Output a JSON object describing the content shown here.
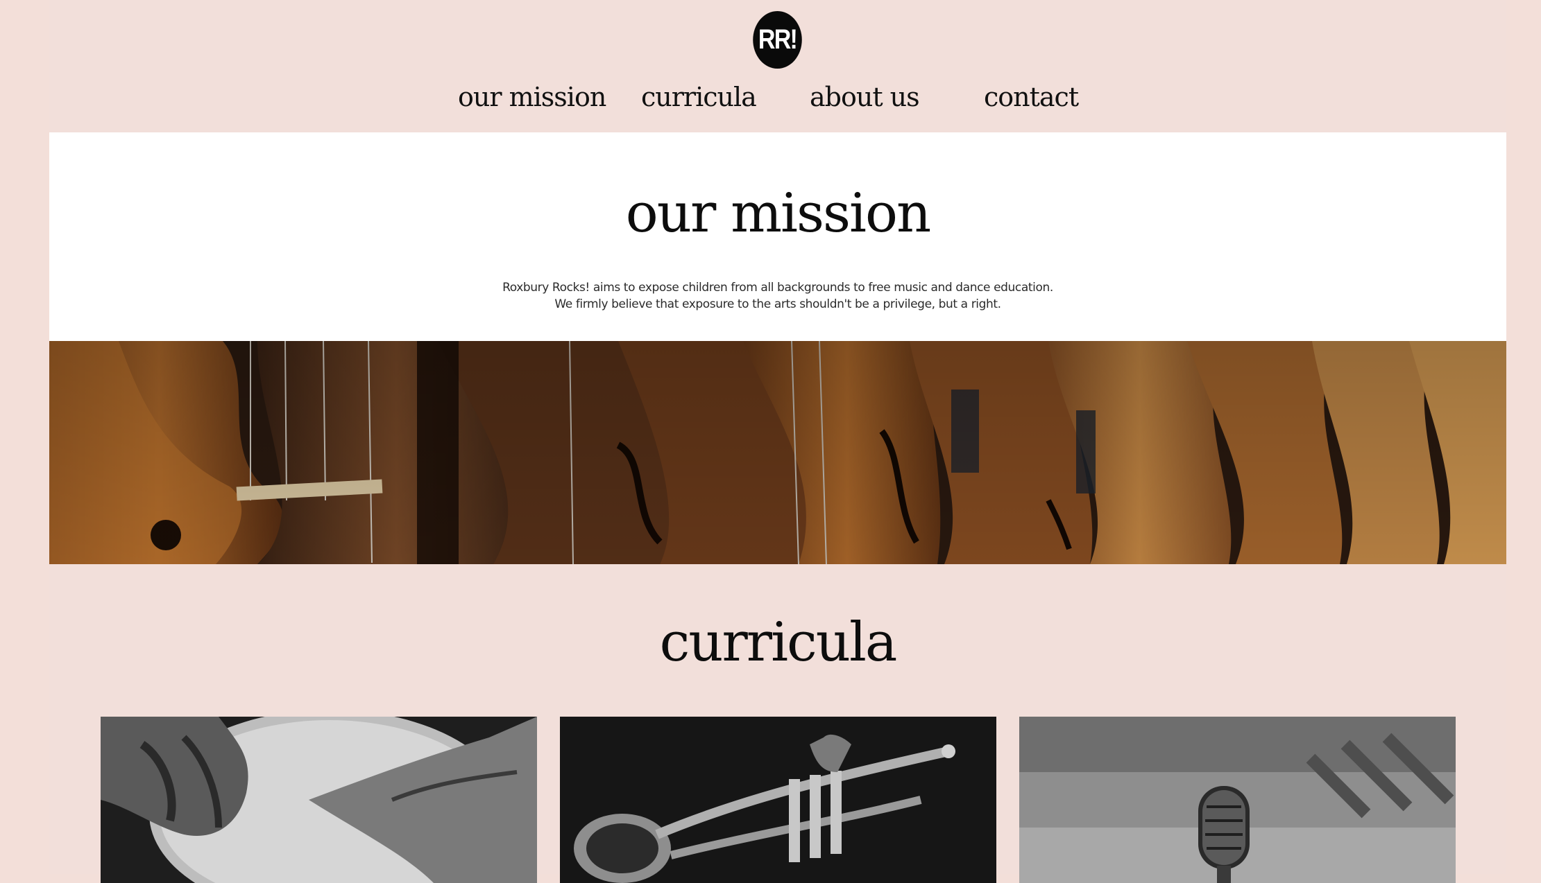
{
  "logo": {
    "text": "RR!"
  },
  "nav": {
    "items": [
      {
        "label": "our mission"
      },
      {
        "label": "curricula"
      },
      {
        "label": "about us"
      },
      {
        "label": "contact"
      }
    ]
  },
  "mission": {
    "title": "our mission",
    "text": "Roxbury Rocks! aims to expose children from all backgrounds to free music and dance education. We firmly believe that exposure to the arts shouldn't be a privilege, but a right."
  },
  "curricula": {
    "title": "curricula",
    "cards": [
      {
        "image": "drum-hands-photo"
      },
      {
        "image": "trumpet-photo"
      },
      {
        "image": "microphone-photo"
      }
    ]
  },
  "colors": {
    "background": "#f2dfda",
    "white_panel": "#ffffff",
    "text": "#111111",
    "logo_bg": "#0a0a0a"
  }
}
